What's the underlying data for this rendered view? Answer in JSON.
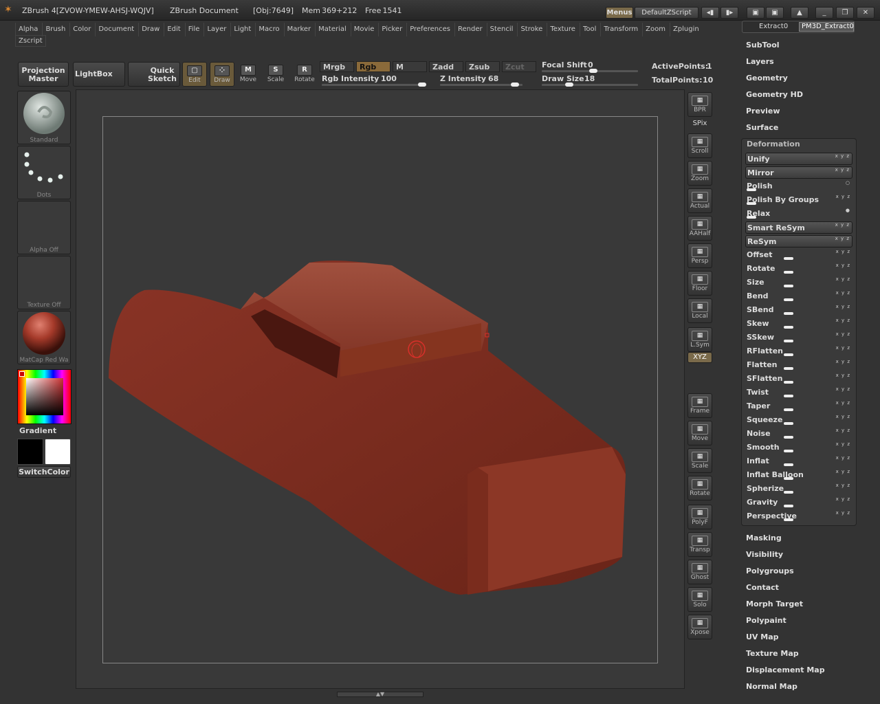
{
  "title": {
    "app": "ZBrush 4[ZVOW-YMEW-AHSJ-WQJV]",
    "document": "ZBrush Document",
    "obj": "[Obj:7649]",
    "mem": "Mem 369+212",
    "free": "Free 1541",
    "menus_btn": "Menus",
    "script_btn": "DefaultZScript"
  },
  "menubar": [
    "Alpha",
    "Brush",
    "Color",
    "Document",
    "Draw",
    "Edit",
    "File",
    "Layer",
    "Light",
    "Macro",
    "Marker",
    "Material",
    "Movie",
    "Picker",
    "Preferences",
    "Render",
    "Stencil",
    "Stroke",
    "Texture",
    "Tool",
    "Transform",
    "Zoom",
    "Zplugin"
  ],
  "zscript": "Zscript",
  "shelf": {
    "projection_master_1": "Projection",
    "projection_master_2": "Master",
    "lightbox": "LightBox",
    "quick_sketch_1": "Quick",
    "quick_sketch_2": "Sketch",
    "edit": "Edit",
    "draw": "Draw",
    "move": "Move",
    "scale": "Scale",
    "rotate": "Rotate",
    "mrgb": "Mrgb",
    "rgb": "Rgb",
    "m": "M",
    "zadd": "Zadd",
    "zsub": "Zsub",
    "zcut": "Zcut",
    "rgb_intensity_label": "Rgb Intensity",
    "rgb_intensity": "100",
    "z_intensity_label": "Z Intensity",
    "z_intensity": "68",
    "focal_shift_label": "Focal Shift",
    "focal_shift": "0",
    "draw_size_label": "Draw Size",
    "draw_size": "18",
    "active_points_label": "ActivePoints:",
    "active_points": "1",
    "total_points_label": "TotalPoints:",
    "total_points": "10"
  },
  "left": {
    "brush": "Standard",
    "stroke": "Dots",
    "alpha": "Alpha Off",
    "texture": "Texture Off",
    "material": "MatCap Red Wa",
    "gradient": "Gradient",
    "switch_color": "SwitchColor"
  },
  "right_tools": [
    "BPR",
    "SPix",
    "Scroll",
    "Zoom",
    "Actual",
    "AAHalf",
    "Persp",
    "Floor",
    "Local",
    "L.Sym",
    "XYZ",
    "Frame",
    "Move",
    "Scale",
    "Rotate",
    "PolyF",
    "Transp",
    "Ghost",
    "Solo",
    "Xpose"
  ],
  "tool_panel": {
    "extract_tab": "Extract0",
    "pm3d_tab": "PM3D_Extract0",
    "top_items": [
      "SubTool",
      "Layers",
      "Geometry",
      "Geometry HD",
      "Preview",
      "Surface"
    ],
    "deformation_title": "Deformation",
    "deformation_items": [
      "Unify",
      "Mirror",
      "Polish",
      "Polish By Groups",
      "Relax",
      "Smart ReSym",
      "ReSym",
      "Offset",
      "Rotate",
      "Size",
      "Bend",
      "SBend",
      "Skew",
      "SSkew",
      "RFlatten",
      "Flatten",
      "SFlatten",
      "Twist",
      "Taper",
      "Squeeze",
      "Noise",
      "Smooth",
      "Inflat",
      "Inflat Balloon",
      "Spherize",
      "Gravity",
      "Perspective"
    ],
    "bottom_items": [
      "Masking",
      "Visibility",
      "Polygroups",
      "Contact",
      "Morph Target",
      "Polypaint",
      "UV Map",
      "Texture Map",
      "Displacement Map",
      "Normal Map"
    ]
  },
  "colors": {
    "model": "#7a2e22",
    "accent": "#8a6a3a"
  }
}
